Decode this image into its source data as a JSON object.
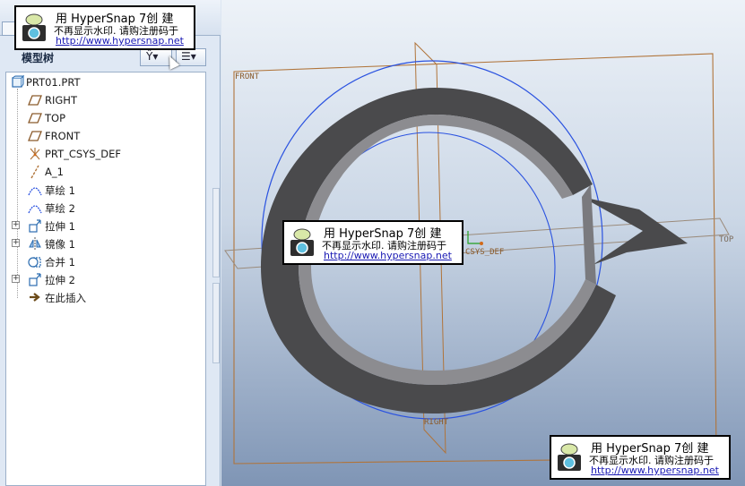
{
  "model_tree": {
    "title": "模型树",
    "settings_glyph": "Ŷ▾",
    "show_glyph": "☰▾",
    "items": [
      {
        "label": "PRT01.PRT",
        "icon": "part-icon",
        "expandable": false
      },
      {
        "label": "RIGHT",
        "icon": "datum-plane-icon",
        "expandable": false
      },
      {
        "label": "TOP",
        "icon": "datum-plane-icon",
        "expandable": false
      },
      {
        "label": "FRONT",
        "icon": "datum-plane-icon",
        "expandable": false
      },
      {
        "label": "PRT_CSYS_DEF",
        "icon": "csys-icon",
        "expandable": false
      },
      {
        "label": "A_1",
        "icon": "datum-axis-icon",
        "expandable": false
      },
      {
        "label": "草绘 1",
        "icon": "sketch-icon",
        "expandable": false
      },
      {
        "label": "草绘 2",
        "icon": "sketch-icon",
        "expandable": false
      },
      {
        "label": "拉伸 1",
        "icon": "extrude-icon",
        "expandable": true
      },
      {
        "label": "镜像 1",
        "icon": "mirror-icon",
        "expandable": true
      },
      {
        "label": "合并 1",
        "icon": "merge-icon",
        "expandable": false
      },
      {
        "label": "拉伸 2",
        "icon": "extrude-icon",
        "expandable": true
      },
      {
        "label": "在此插入",
        "icon": "insert-arrow-icon",
        "expandable": false
      }
    ],
    "expander_symbol": "+"
  },
  "viewport": {
    "labels": {
      "front": "FRONT",
      "top": "TOP",
      "right": "RIGHT",
      "csys": "CSYS_DEF"
    },
    "colors": {
      "datum_plane": "#b0743a",
      "sketch_curve": "#2a52e0",
      "solid": "#4a4a4c"
    }
  },
  "watermarks": [
    {
      "line1": "用 HyperSnap 7创 建",
      "line2": "不再显示水印. 请购注册码于",
      "line3": "http://www.hypersnap.net"
    },
    {
      "line1": "用 HyperSnap 7创 建",
      "line2": "不再显示水印. 请购注册码于",
      "line3": "http://www.hypersnap.net"
    },
    {
      "line1": "用 HyperSnap 7创 建",
      "line2": "不再显示水印. 请购注册码于",
      "line3": "http://www.hypersnap.net"
    }
  ]
}
